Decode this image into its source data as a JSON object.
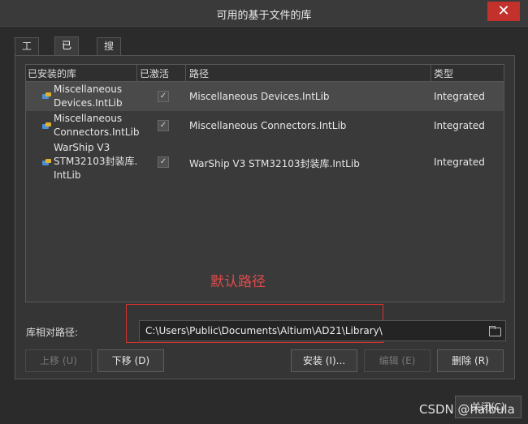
{
  "window": {
    "title": "可用的基于文件的库",
    "close_glyph": "✕"
  },
  "tabs": [
    {
      "label": "工程"
    },
    {
      "label": "已安装"
    },
    {
      "label": "搜索路径"
    }
  ],
  "table": {
    "headers": [
      "已安装的库",
      "已激活",
      "路径",
      "类型"
    ],
    "rows": [
      {
        "name_line1": "Miscellaneous",
        "name_line2": "Devices.IntLib",
        "active_mark": "✓",
        "path": "Miscellaneous Devices.IntLib",
        "type": "Integrated"
      },
      {
        "name_line1": "Miscellaneous",
        "name_line2": "Connectors.IntLib",
        "active_mark": "✓",
        "path": "Miscellaneous Connectors.IntLib",
        "type": "Integrated"
      },
      {
        "name_line1": "WarShip V3",
        "name_line2": "STM32103封装库.",
        "name_line3": "IntLib",
        "active_mark": "✓",
        "path": "WarShip V3 STM32103封装库.IntLib",
        "type": "Integrated"
      }
    ]
  },
  "annotation": {
    "text": "默认路径",
    "color": "#e04a4a"
  },
  "relative_path": {
    "label": "库相对路径:",
    "value": "C:\\Users\\Public\\Documents\\Altium\\AD21\\Library\\"
  },
  "buttons": {
    "move_up": "上移 (U)",
    "move_down": "下移 (D)",
    "install": "安装 (I)...",
    "edit": "编辑 (E)",
    "remove": "删除 (R)",
    "close": "关闭(C)"
  },
  "watermark": "CSDN @haibula"
}
